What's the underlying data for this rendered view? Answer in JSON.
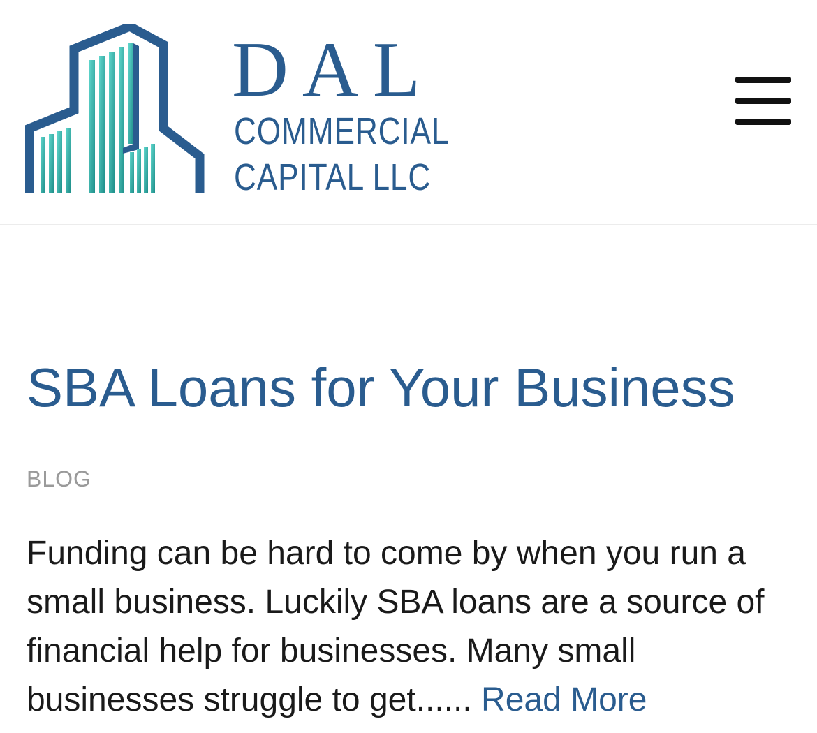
{
  "header": {
    "logo": {
      "wordmark": "DAL",
      "subline_1": "COMMERCIAL",
      "subline_2": "CAPITAL LLC"
    },
    "menu_icon": "hamburger-menu-icon"
  },
  "post": {
    "title": "SBA Loans for Your Business",
    "category": "BLOG",
    "excerpt": "Funding can be hard to come by when you run a small business. Luckily SBA loans are a source of financial help for businesses. Many small businesses struggle to get......",
    "read_more": "Read More"
  },
  "colors": {
    "brand_blue": "#2a5c8f",
    "logo_teal": "#3cbfb4",
    "muted_gray": "#9a9a9a",
    "text": "#1a1a1a"
  }
}
